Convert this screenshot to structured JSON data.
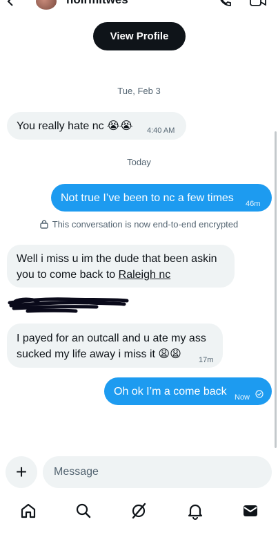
{
  "header": {
    "username": "noirmitwes",
    "view_profile_label": "View Profile",
    "icons": [
      "back-arrow-icon",
      "phone-icon",
      "video-icon"
    ]
  },
  "messages": [
    {
      "type": "date",
      "text": "Tue, Feb 3"
    },
    {
      "type": "incoming",
      "text": "You really hate nc 😭😭",
      "time": "4:40 AM"
    },
    {
      "type": "date",
      "text": "Today"
    },
    {
      "type": "outgoing",
      "text": "Not true I’ve been to nc a few times",
      "time": "46m"
    },
    {
      "type": "system",
      "text": "This conversation is now end-to-end encrypted"
    },
    {
      "type": "incoming",
      "lines": [
        "Well i miss u im the dude that been askin",
        "you to come back to"
      ],
      "link_text": "Raleigh nc"
    },
    {
      "type": "incoming",
      "lines": [
        "I payed for an outcall and u ate my ass",
        "sucked my life away i miss it 😩😩"
      ],
      "time": "17m"
    },
    {
      "type": "outgoing",
      "text": "Oh ok I’m a come back",
      "time": "Now"
    }
  ],
  "compose": {
    "plus_label": "+",
    "placeholder": "Message"
  },
  "bottom_nav": [
    "home-icon",
    "search-icon",
    "grok-icon",
    "notifications-icon",
    "messages-icon"
  ],
  "colors": {
    "accent": "#1d9bf0",
    "bubble_in": "#eff3f4",
    "text": "#0f1419",
    "muted": "#536471"
  }
}
